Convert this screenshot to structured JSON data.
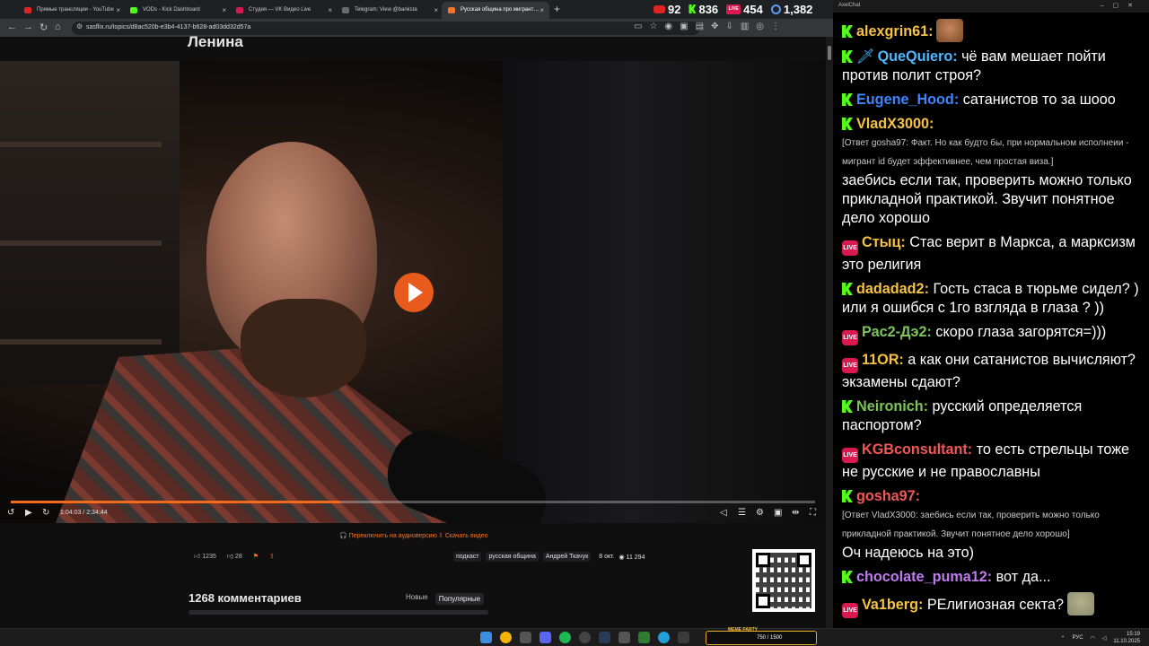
{
  "browser": {
    "tabs": [
      {
        "label": "Прямые трансляции - YouTube",
        "color": "#e02424"
      },
      {
        "label": "VODs - Kick Dashboard",
        "color": "#53fc18"
      },
      {
        "label": "Студия — VK Видео Live",
        "color": "#d9194f"
      },
      {
        "label": "Telegram: View @banksta",
        "color": "#6b6b6b"
      },
      {
        "label": "Русская община про мигрант…",
        "color": "#f2772b"
      }
    ],
    "url": "sasflix.ru/topics/d8ac520b-e3b4-4137-b628-ad03dd32d57a"
  },
  "stream_stats": {
    "youtube": "92",
    "kick": "836",
    "vk": "454",
    "viewers": "1,382",
    "live_badge": "LIVE"
  },
  "page": {
    "title": "Ленина",
    "video": {
      "current_time": "1:04:03",
      "duration": "2:34:44",
      "progress": 0.41
    },
    "audio_link": "Переключить на аудиоверсию",
    "download_link": "Скачать видео",
    "likes": "1235",
    "dislikes": "28",
    "tags": [
      "подкаст",
      "русская община",
      "Андрей Ткачук"
    ],
    "date": "8 окт.",
    "views": "11 294",
    "comments_title": "1268 комментариев",
    "sort_new": "Новые",
    "sort_popular": "Популярные"
  },
  "chat": {
    "window_title": "AxelChat",
    "messages": [
      {
        "platform": "kick",
        "nick": "alexgrin61:",
        "color": "#f6c243",
        "text": "",
        "emote": "#7a4a2a"
      },
      {
        "platform": "kick",
        "nick": "QueQuiero:",
        "color": "#4fb8ff",
        "text": "чё вам мешает пойти против полит строя?",
        "sword": "🗡"
      },
      {
        "platform": "kick",
        "nick": "Eugene_Hood:",
        "color": "#3f84ff",
        "text": "сатанистов то за шооо"
      },
      {
        "platform": "kick",
        "nick": "VladX3000:",
        "color": "#f6c243",
        "reply": "[Ответ gosha97: Факт. Но как будто бы, при нормальном исполнеии - мигрант id будет эффективнее, чем простая виза.]",
        "text": "заебись если так, проверить можно только прикладной практикой. Звучит понятное дело хорошо"
      },
      {
        "platform": "vk",
        "nick": "Стыц:",
        "color": "#f6c243",
        "text": "Стас верит в Маркса, а марксизм это религия"
      },
      {
        "platform": "kick",
        "nick": "dadadad2:",
        "color": "#f6c243",
        "text": "Гость стаса в тюрьме сидел? ) или я ошибся с 1го взгляда в глаза ? ))"
      },
      {
        "platform": "vk",
        "nick": "Рас2-Дэ2:",
        "color": "#7dc35c",
        "text": "скоро глаза загорятся=)))"
      },
      {
        "platform": "vk",
        "nick": "11OR:",
        "color": "#f6c243",
        "text": "а как они сатанистов вычисляют? экзамены сдают?"
      },
      {
        "platform": "kick",
        "nick": "Neironich:",
        "color": "#7dc35c",
        "text": "русский определяется паспортом?"
      },
      {
        "platform": "vk",
        "nick": "KGBconsultant:",
        "color": "#f25757",
        "text": "то есть стрельцы тоже не русские и не православны"
      },
      {
        "platform": "kick",
        "nick": "gosha97:",
        "color": "#f25757",
        "reply": "[Ответ VladX3000: заебись если так, проверить можно только прикладной практикой. Звучит понятное дело хорошо]",
        "text": "Оч надеюсь на это)"
      },
      {
        "platform": "kick",
        "nick": "chocolate_puma12:",
        "color": "#c07af0",
        "text": "вот да..."
      },
      {
        "platform": "vk",
        "nick": "Va1berg:",
        "color": "#f6c243",
        "text": "РЕлигиозная секта?",
        "emote": "#8a8a70"
      }
    ]
  },
  "taskbar": {
    "meme_label": "MEME PARTY",
    "meme_progress": "750 / 1500",
    "lang": "РУС",
    "time": "15:19",
    "date": "11.10.2025"
  }
}
